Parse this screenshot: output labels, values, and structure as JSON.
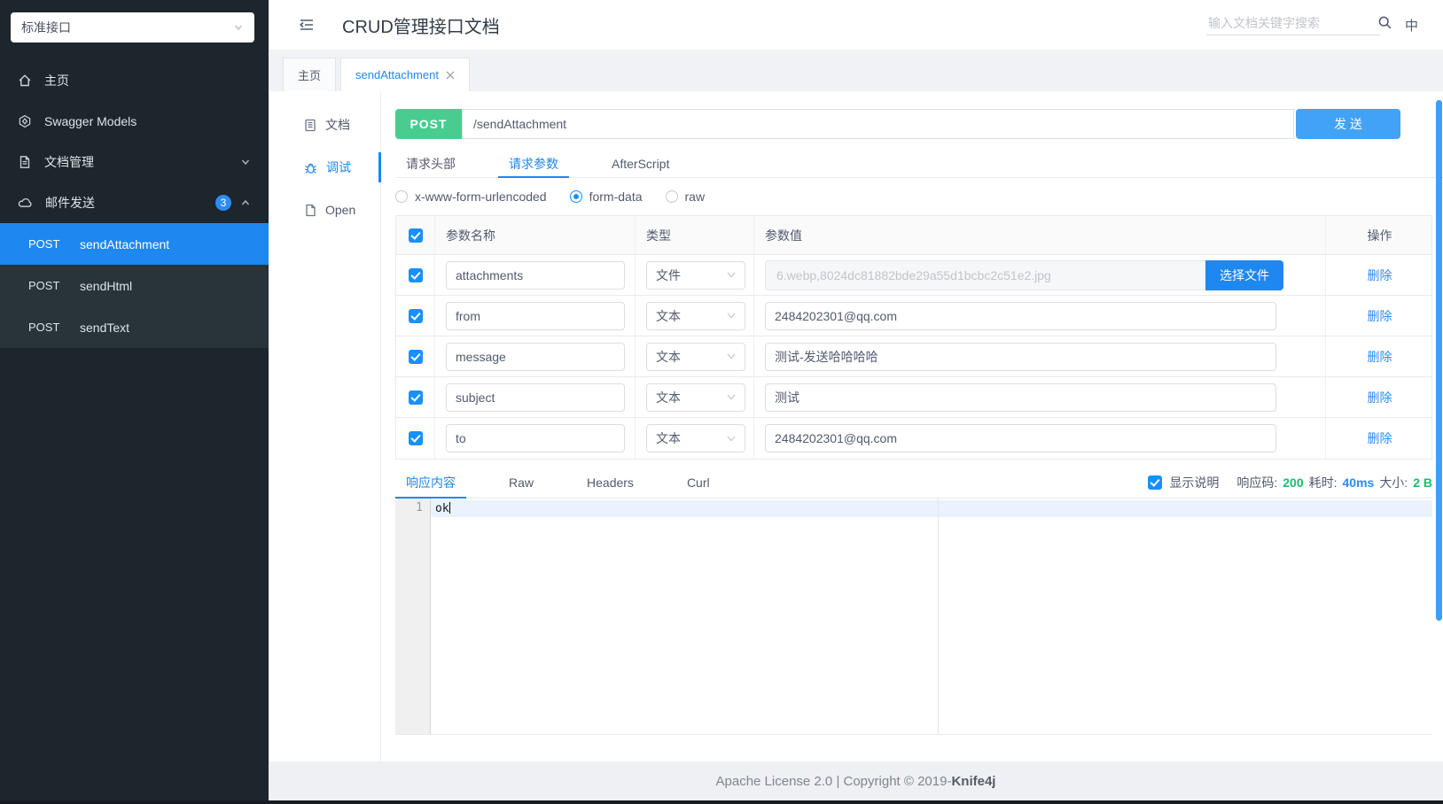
{
  "colors": {
    "accent_blue": "#1e87f0",
    "checkbox_blue": "#1890ff",
    "send_button_blue": "#42a2f5",
    "method_green": "#49cc90",
    "success_green": "#19be6b",
    "info_blue": "#2d8cf0",
    "sidebar_bg": "#1d262c",
    "sidebar_active": "#1e87f0"
  },
  "sidebar": {
    "group_select": "标准接口",
    "items": [
      {
        "label": "主页",
        "icon": "home-icon"
      },
      {
        "label": "Swagger Models",
        "icon": "models-icon"
      },
      {
        "label": "文档管理",
        "icon": "doc-manage-icon",
        "chevron": "down"
      },
      {
        "label": "邮件发送",
        "icon": "mail-cloud-icon",
        "badge": "3",
        "chevron": "up"
      }
    ],
    "submenu": [
      {
        "method": "POST",
        "name": "sendAttachment",
        "active": true
      },
      {
        "method": "POST",
        "name": "sendHtml",
        "active": false
      },
      {
        "method": "POST",
        "name": "sendText",
        "active": false
      }
    ]
  },
  "header": {
    "title": "CRUD管理接口文档",
    "search_placeholder": "输入文档关键字搜索",
    "lang": "中"
  },
  "tabs": [
    {
      "label": "主页",
      "active": false
    },
    {
      "label": "sendAttachment",
      "active": true,
      "closable": true
    }
  ],
  "side_nav": [
    {
      "label": "文档",
      "icon": "doc-icon",
      "active": false
    },
    {
      "label": "调试",
      "icon": "bug-icon",
      "active": true
    },
    {
      "label": "Open",
      "icon": "file-icon",
      "active": false
    }
  ],
  "request": {
    "method": "POST",
    "url": "/sendAttachment",
    "send_label": "发 送",
    "tabs": [
      "请求头部",
      "请求参数",
      "AfterScript"
    ],
    "active_tab": "请求参数",
    "body_types": [
      {
        "label": "x-www-form-urlencoded",
        "checked": false
      },
      {
        "label": "form-data",
        "checked": true
      },
      {
        "label": "raw",
        "checked": false
      }
    ],
    "table": {
      "headers": [
        "参数名称",
        "类型",
        "参数值",
        "操作"
      ],
      "delete_label": "删除",
      "choose_file_label": "选择文件",
      "rows": [
        {
          "checked": true,
          "name": "attachments",
          "type": "文件",
          "value": "6.webp,8024dc81882bde29a55d1bcbc2c51e2.jpg",
          "is_file": true
        },
        {
          "checked": true,
          "name": "from",
          "type": "文本",
          "value": "2484202301@qq.com",
          "is_file": false
        },
        {
          "checked": true,
          "name": "message",
          "type": "文本",
          "value": "测试-发送哈哈哈哈",
          "is_file": false
        },
        {
          "checked": true,
          "name": "subject",
          "type": "文本",
          "value": "测试",
          "is_file": false
        },
        {
          "checked": true,
          "name": "to",
          "type": "文本",
          "value": "2484202301@qq.com",
          "is_file": false
        }
      ]
    }
  },
  "response": {
    "tabs": [
      "响应内容",
      "Raw",
      "Headers",
      "Curl"
    ],
    "active_tab": "响应内容",
    "show_desc_label": "显示说明",
    "meta": [
      {
        "label": "响应码:",
        "value": "200",
        "color": "#19be6b"
      },
      {
        "label": "耗时:",
        "value": "40ms",
        "color": "#2d8cf0"
      },
      {
        "label": "大小:",
        "value": "2 B",
        "color": "#19be6b"
      }
    ],
    "editor": {
      "line_number": "1",
      "content": "ok"
    }
  },
  "footer": {
    "text": "Apache License 2.0 | Copyright © 2019-",
    "brand": "Knife4j"
  }
}
